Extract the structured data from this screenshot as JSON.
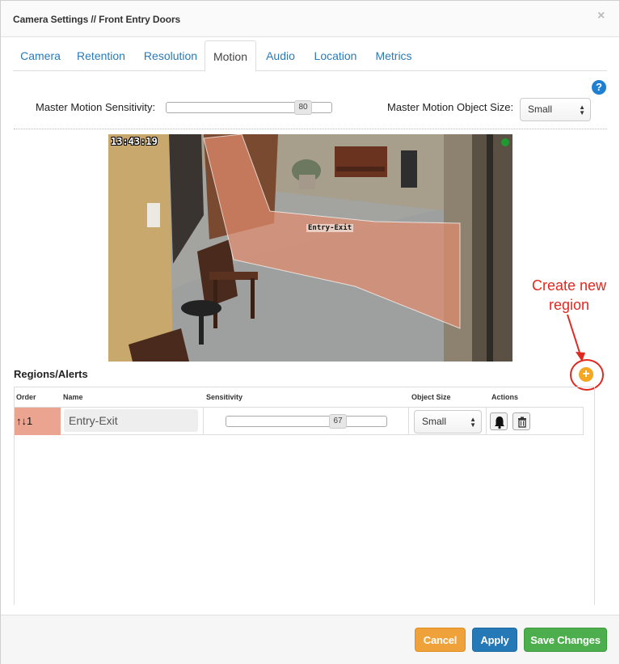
{
  "window": {
    "title": "Camera Settings // Front Entry Doors",
    "close_symbol": "×"
  },
  "tabs": [
    {
      "label": "Camera",
      "active": false
    },
    {
      "label": "Retention",
      "active": false
    },
    {
      "label": "Resolution",
      "active": false
    },
    {
      "label": "Motion",
      "active": true
    },
    {
      "label": "Audio",
      "active": false
    },
    {
      "label": "Location",
      "active": false
    },
    {
      "label": "Metrics",
      "active": false
    }
  ],
  "help_icon": "?",
  "motion": {
    "sensitivity_label": "Master Motion Sensitivity:",
    "sensitivity_value": "80",
    "object_size_label": "Master Motion Object Size:",
    "object_size_value": "Small"
  },
  "camera_view": {
    "timestamp": "13:43:19",
    "region_label": "Entry-Exit",
    "status_color": "#1e9a2f",
    "region_color": "#eba48f"
  },
  "annotation": {
    "line1": "Create new",
    "line2": "region"
  },
  "regions": {
    "title": "Regions/Alerts",
    "add_symbol": "+",
    "columns": [
      "Order",
      "Name",
      "Sensitivity",
      "Object Size",
      "Actions"
    ],
    "rows": [
      {
        "order": "1",
        "name": "Entry-Exit",
        "sensitivity": "67",
        "object_size": "Small"
      }
    ]
  },
  "footer": {
    "cancel": "Cancel",
    "apply": "Apply",
    "save": "Save Changes"
  },
  "colors": {
    "cancel": "#f0a23a",
    "apply": "#2579b6",
    "save": "#4cae4c",
    "accent": "#2a7ab8",
    "annotation": "#e0281f"
  }
}
